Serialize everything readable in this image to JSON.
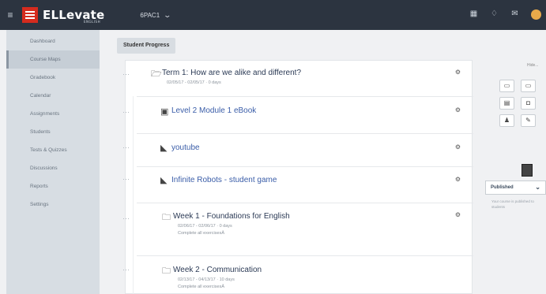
{
  "header": {
    "brand_name": "ELLevate",
    "brand_sub": "ENGLISH",
    "class_select": "6PAC1",
    "colors": {
      "topbar": "#2c3440",
      "logo": "#d52b1e"
    },
    "icons": [
      "grid-icon",
      "bell-icon",
      "mail-icon",
      "profile-icon"
    ]
  },
  "sidebar": {
    "items": [
      {
        "label": "Dashboard"
      },
      {
        "label": "Course Maps"
      },
      {
        "label": "Gradebook"
      },
      {
        "label": "Calendar"
      },
      {
        "label": "Assignments"
      },
      {
        "label": "Students"
      },
      {
        "label": "Tests & Quizzes"
      },
      {
        "label": "Discussions"
      },
      {
        "label": "Reports"
      },
      {
        "label": "Settings"
      }
    ],
    "active_index": 1
  },
  "main": {
    "tab_label": "Student Progress",
    "rows": [
      {
        "icon": "folder-open-icon",
        "title": "Term 1: How are we alike and different?",
        "sub1": "02/05/17 - 02/05/17 · 0 days",
        "sub2": ""
      },
      {
        "icon": "book-icon",
        "title": "Level 2 Module 1 eBook",
        "sub1": "",
        "sub2": ""
      },
      {
        "icon": "tag-icon",
        "title": "youtube",
        "sub1": "",
        "sub2": ""
      },
      {
        "icon": "tag-icon",
        "title": "Infinite Robots - student game",
        "sub1": "",
        "sub2": ""
      },
      {
        "icon": "folder-icon",
        "title": "Week 1 - Foundations for English",
        "sub1": "02/06/17 - 02/06/17 · 0 days",
        "sub2": "Complete all exercisesÂ"
      },
      {
        "icon": "folder-icon",
        "title": "Week 2 - Communication",
        "sub1": "02/13/17 - 04/13/17 · 10 days",
        "sub2": "Complete all exercisesÂ"
      }
    ]
  },
  "right_panel": {
    "more_label": "Hide...",
    "publish_status": "Published",
    "publish_note": "Your course is published to students"
  }
}
